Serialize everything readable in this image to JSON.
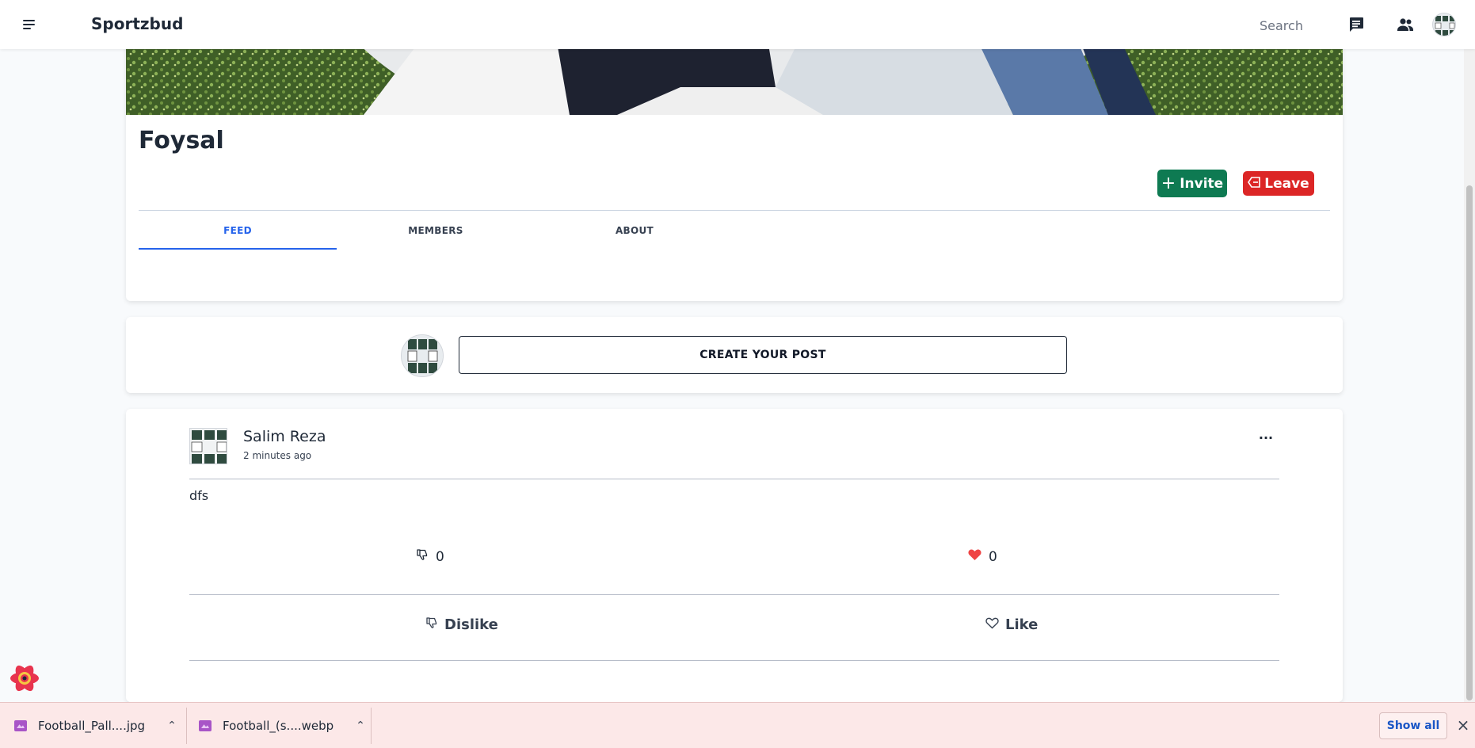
{
  "navbar": {
    "brand": "Sportzbud",
    "search_placeholder": "Search",
    "icons": [
      "menu-icon",
      "chat-icon",
      "people-icon",
      "avatar"
    ]
  },
  "group": {
    "name": "Foysal",
    "invite_label": "Invite",
    "leave_label": "Leave",
    "tabs": [
      {
        "label": "FEED",
        "active": true
      },
      {
        "label": "MEMBERS",
        "active": false
      },
      {
        "label": "ABOUT",
        "active": false
      }
    ]
  },
  "create_post": {
    "button_label": "CREATE YOUR POST"
  },
  "post": {
    "author": "Salim Reza",
    "time": "2 minutes ago",
    "more": "...",
    "text": "dfs",
    "dislike_count": "0",
    "like_count": "0",
    "dislike_label": "Dislike",
    "like_label": "Like"
  },
  "downloads": {
    "items": [
      {
        "name": "Football_Pall....jpg"
      },
      {
        "name": "Football_(s....webp"
      }
    ],
    "show_all_label": "Show all"
  },
  "colors": {
    "invite": "#0e7a52",
    "leave": "#dc2626",
    "accent": "#2563eb",
    "heart": "#ef4444",
    "download_bar": "#fce8e8"
  }
}
